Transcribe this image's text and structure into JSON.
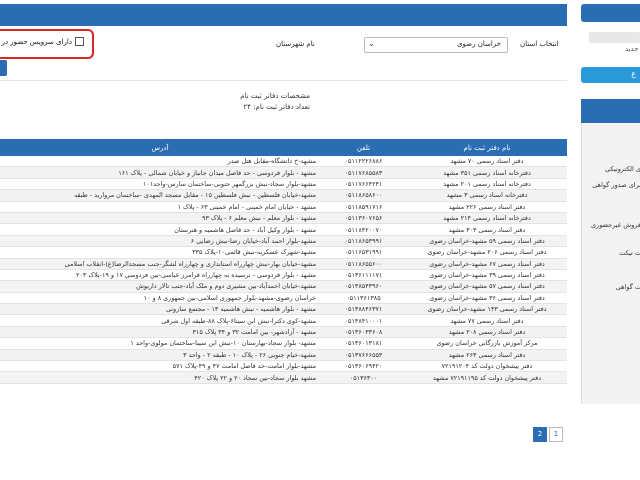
{
  "filter": {
    "province_label": "انتخاب استان",
    "province_value": "خراسان رضوی",
    "city_label": "نام شهرستان",
    "service_label": "دارای سرویس حضور در"
  },
  "summary": {
    "line1": "مشخصات دفاتر ثبت نام",
    "line2": "تعداد دفاتر ثبت نام: ۲۴"
  },
  "table": {
    "headers": {
      "name": "نام دفتر ثبت نام",
      "tel": "تلفن",
      "addr": "آدرس"
    },
    "rows": [
      {
        "name": "دفتر اسناد رسمی ۷۰ مشهد",
        "tel": "۰۵۱۱۲۲۲۶۸۸۶",
        "addr": "مشهد-خ دانشگاه-مقابل هتل صدر"
      },
      {
        "name": "دفترخانه اسناد رسمی ۳۵۱ مشهد",
        "tel": "۰۵۱۱۷۶۸۵۵۸۳",
        "addr": "مشهد - بلوار فردوسی - حد فاصل میدان جانباز و خیابان شمالی - پلاک ۱۶۱"
      },
      {
        "name": "دفترخانه اسناد رسمی ۲۰۱ مشهد",
        "tel": "۰۵۱۱۷۶۶۴۲۴۱",
        "addr": "مشهد-بلوار سجاد-نبش بزرگمهر جنوبی-ساختمان سارس-واحد۱۰۱"
      },
      {
        "name": "دفترخانه اسناد رسمی ۳ مشهد",
        "tel": "۰۵۱۱۸۶۵۸۶۰۰",
        "addr": "مشهد-خیابان فلسطین - نبش فلسطین ۱۵ - مقابل مسجد المهدی -ساختمان مروارید - طبقه"
      },
      {
        "name": "دفتر اسناد رسمی ۲۲۶ مشهد",
        "tel": "۰۵۱۱۸۵۹۱۷۱۶",
        "addr": "مشهد - خیابان امام خمینی - امام خمینی ۶۳ - پلاک ۱"
      },
      {
        "name": "دفترخانه اسناد رسمی ۲۱۴ مشهد",
        "tel": "۰۵۱۱۳۶۰۷۶۵۶",
        "addr": "مشهد - بلوار معلم - نبش معلم ۶ - پلاک ۹۳"
      },
      {
        "name": "دفتر اسناد رسمی ۳۰۳ مشهد",
        "tel": "۰۵۱۱۸۴۲۰۰۷۰",
        "addr": "مشهد - بلوار وکیل آباد - حد فاصل هاشمیه و هنرستان"
      },
      {
        "name": "دفتر اسناد رسمی ۵۹ مشهد-خراسان رضوی",
        "tel": "۰۵۱۱۸۶۵۳۹۹۱",
        "addr": "مشهد-بلوار احمد آباد-خیابان رضا-نبش رضایی ۶"
      },
      {
        "name": "دفتر اسناد رسمی ۲۰۶ مشهد-خراسان رضوی",
        "tel": "۰۵۱۱۶۵۳۱۹۹۱",
        "addr": "مشهد-شهرک عسکریه-نبش قائمی۱۰-پلاک ۳۳۵"
      },
      {
        "name": "دفتر اسناد رسمی ۶۷ مشهد-خراسان رضوی",
        "tel": "۰۵۱۱۸۶۵۵۶۰۰",
        "addr": "مشهد-خیابان بهار-نبش چهارراه استانداری و چهارراه لشگر-جنب مسجدالرضا(ع)-انقلاب اسلامی"
      },
      {
        "name": "دفتر اسناد رسمی ۳۹ مشهد-خراسان رضوی",
        "tel": "۰۵۱۳۶۱۱۱۱۷۱",
        "addr": "مشهد - بلوار فردوسی - نرسیده به چهارراه فرامرز عباسی-بین فردوسی ۱۷ و ۱۹-پلاک ۲۰۳"
      },
      {
        "name": "دفتر اسناد رسمی ۵۷ مشهد-خراسان رضوی",
        "tel": "۰۵۱۳۸۵۴۳۹۶۰",
        "addr": "مشهد-خیابان احمدآباد-بین مشیری دوم و ملک آباد-جنب تالار داریوش"
      },
      {
        "name": "دفتر اسناد رسمی ۳۶ مشهد-خراسان رضوی",
        "tel": "۰۵۱۱۳۶۱۳۸۵",
        "addr": "خراسان رضوی-مشهد-بلوار جمهوری اسلامی-بین جمهوری ۸ و ۱۰"
      },
      {
        "name": "دفتر اسناد رسمی ۱۴۳ مشهد-خراسان رضوی",
        "tel": "۰۵۱۳۸۸۴۶۳۷۱",
        "addr": "مشهد - بلوار هاشمیه - نبش هاشمیه ۱۳ - مجتمع سارونی"
      },
      {
        "name": "دفتر اسناد رسمی ۷۷ مشهد",
        "tel": "۰۵۱۳۸۴۱۰۰۰۱",
        "addr": "مشهد-کوی دکترا-نبش ابن سینا۶-پلاک ۸۸-طبقه اول شرقی"
      },
      {
        "name": "دفتر اسناد رسمی ۲۰۸ مشهد",
        "tel": "۰۵۱۳۶۰۳۳۶۰۸",
        "addr": "مشهد - آزادشهر- بین امامت ۳۲ و ۳۴ پلاک ۳۱۵"
      },
      {
        "name": "مرکز آموزش بازرگانی خراسان رضوی",
        "tel": "۰۵۱۳۶۰۱۳۱۸۱",
        "addr": "مشهد- بلوار سجاد-بهارستان ۱۰-نبش ابن سینا-ساختمان مولوی-واحد ۱"
      },
      {
        "name": "دفتر اسناد رسمی ۲۶۳ مشهد",
        "tel": "۰۵۱۳۷۶۶۶۵۵۳",
        "addr": "مشهد-خیام جنوبی ۲۶ - پلاک ۱۰ - طبقه ۲ - واحد ۳"
      },
      {
        "name": "دفتر پیشخوان دولت کد ۷۲۱۹۱۲۰۴",
        "tel": "۰۵۱۳۶۰۶۹۴۲۰",
        "addr": "مشهد-بلوار امامت-حد فاصل امامت ۴۷ و ۴۹-پلاک ۵۷۱"
      },
      {
        "name": "دفتر پیشخوان دولت کد ۷۲۱۹۱۱۹۵ مشهد",
        "tel": "۰۵۱۳۶۳۰۰",
        "addr": "مشهد بلوار سجاد-بین سجاد ۲۰ و ۲۲ پلاک ۴۲۰"
      }
    ]
  },
  "pager": {
    "page1": "1",
    "page2": "2"
  },
  "sidebar": {
    "field_cut": "جدید",
    "button_glyph": "ع",
    "items": [
      "ی الکترونیکی",
      "برای صدور گواهی",
      "فروش غیرحضوری",
      "ت تیکت",
      "ت گواهی"
    ]
  },
  "colors": {
    "primary": "#2a6db2",
    "highlight": "#d9262a",
    "accent": "#2a9bd8"
  }
}
